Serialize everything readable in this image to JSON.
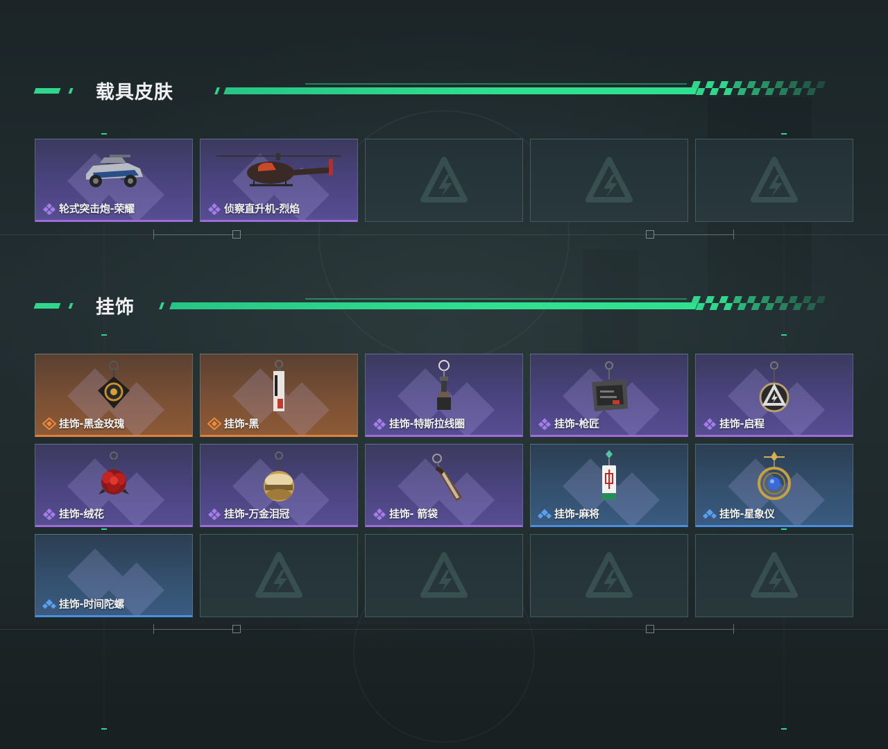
{
  "sections": [
    {
      "title": "载具皮肤",
      "items": [
        {
          "label": "轮式突击炮-荣耀",
          "rarity": "purple",
          "icon": "armored-vehicle-icon"
        },
        {
          "label": "侦察直升机-烈焰",
          "rarity": "purple",
          "icon": "helicopter-icon"
        },
        {
          "label": null,
          "rarity": "empty"
        },
        {
          "label": null,
          "rarity": "empty"
        },
        {
          "label": null,
          "rarity": "empty"
        }
      ]
    },
    {
      "title": "挂饰",
      "items": [
        {
          "label": "挂饰-黑金玫瑰",
          "rarity": "orange",
          "icon": "black-gold-rose-charm-icon"
        },
        {
          "label": "挂饰-黑",
          "rarity": "orange",
          "icon": "black-tag-charm-icon"
        },
        {
          "label": "挂饰-特斯拉线圈",
          "rarity": "purple",
          "icon": "tesla-coil-charm-icon"
        },
        {
          "label": "挂饰-枪匠",
          "rarity": "purple",
          "icon": "gunsmith-charm-icon"
        },
        {
          "label": "挂饰-启程",
          "rarity": "purple",
          "icon": "departure-medal-charm-icon"
        },
        {
          "label": "挂饰-绒花",
          "rarity": "purple",
          "icon": "velvet-flower-charm-icon"
        },
        {
          "label": "挂饰-万金泪冠",
          "rarity": "purple",
          "icon": "golden-crown-charm-icon"
        },
        {
          "label": "挂饰- 箭袋",
          "rarity": "purple",
          "icon": "quiver-charm-icon"
        },
        {
          "label": "挂饰-麻将",
          "rarity": "blue",
          "icon": "mahjong-tile-charm-icon"
        },
        {
          "label": "挂饰-星象仪",
          "rarity": "blue",
          "icon": "astrolabe-charm-icon"
        },
        {
          "label": "挂饰-时间陀螺",
          "rarity": "blue",
          "icon": null
        },
        {
          "label": null,
          "rarity": "empty"
        },
        {
          "label": null,
          "rarity": "empty"
        },
        {
          "label": null,
          "rarity": "empty"
        },
        {
          "label": null,
          "rarity": "empty"
        }
      ]
    }
  ],
  "colors": {
    "accent_green": "#2fd68c",
    "rarity_purple": "#9d6ddc",
    "rarity_orange": "#e3813a",
    "rarity_blue": "#4a8fe0"
  }
}
